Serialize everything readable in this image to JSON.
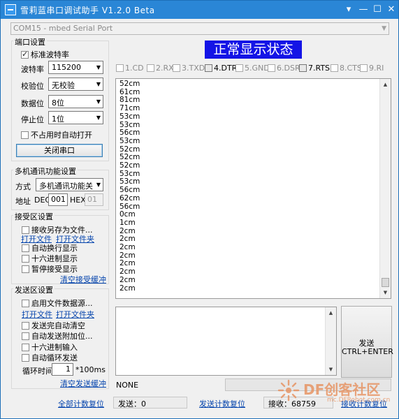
{
  "window": {
    "title": "雪莉蓝串口调试助手  V1.2.0 Beta",
    "controls": [
      "▾",
      "—",
      "☐",
      "✕"
    ]
  },
  "port_select": {
    "value": "COM15 - mbed Serial Port"
  },
  "port_settings": {
    "title": "端口设置",
    "std_baud": {
      "label": "标准波特率",
      "checked": true
    },
    "baud": {
      "label": "波特率",
      "value": "115200"
    },
    "parity": {
      "label": "校验位",
      "value": "无校验"
    },
    "databits": {
      "label": "数据位",
      "value": "8位"
    },
    "stopbits": {
      "label": "停止位",
      "value": "1位"
    },
    "auto_open": {
      "label": "不占用时自动打开",
      "checked": false
    },
    "close_button": "关闭串口"
  },
  "multi": {
    "title": "多机通讯功能设置",
    "mode_label": "方式",
    "mode_value": "多机通讯功能关",
    "addr_label": "地址",
    "dec_label": "DEC",
    "dec_value": "001",
    "hex_label": "HEX",
    "hex_value": "01"
  },
  "recv_settings": {
    "title": "接受区设置",
    "save_to_file": "接收另存为文件...",
    "open_file": "打开文件",
    "open_folder": "打开文件夹",
    "auto_newline": "自动换行显示",
    "hex_display": "十六进制显示",
    "pause_display": "暂停接受显示",
    "clear": "清空接受缓冲"
  },
  "send_settings": {
    "title": "发送区设置",
    "enable_file": "启用文件数据源...",
    "open_file": "打开文件",
    "open_folder": "打开文件夹",
    "auto_clear": "发送完自动清空",
    "auto_append": "自动发送附加位...",
    "hex_input": "十六进制输入",
    "auto_loop": "自动循环发送",
    "loop_label": "循环时间",
    "loop_value": "1",
    "loop_unit": "*100ms",
    "clear": "清空发送缓冲"
  },
  "banner": "正常显示状态",
  "signals": [
    {
      "label": "1.CD",
      "on": false
    },
    {
      "label": "2.RXD",
      "on": false
    },
    {
      "label": "3.TXD",
      "on": false
    },
    {
      "label": "4.DTR",
      "on": true
    },
    {
      "label": "5.GND",
      "on": false
    },
    {
      "label": "6.DSR",
      "on": false
    },
    {
      "label": "7.RTS",
      "on": true
    },
    {
      "label": "8.CTS",
      "on": false
    },
    {
      "label": "9.RI",
      "on": false
    }
  ],
  "received_lines": [
    "52cm",
    "61cm",
    "81cm",
    "71cm",
    "53cm",
    "53cm",
    "56cm",
    "53cm",
    "52cm",
    "52cm",
    "52cm",
    "53cm",
    "53cm",
    "56cm",
    "62cm",
    "56cm",
    "0cm",
    "1cm",
    "2cm",
    "2cm",
    "2cm",
    "2cm",
    "2cm",
    "2cm",
    "2cm",
    "2cm"
  ],
  "send_button": {
    "line1": "发送",
    "line2": "CTRL+ENTER"
  },
  "status": {
    "mode": "NONE"
  },
  "bottom": {
    "reset_all": "全部计数复位",
    "sent_label": "发送：0",
    "reset_send": "发送计数复位",
    "recv_label": "接收：68759",
    "reset_recv": "接收计数复位"
  },
  "watermark": {
    "text": "DF创客社区",
    "url": "mc.DFRobot.com.cn"
  }
}
